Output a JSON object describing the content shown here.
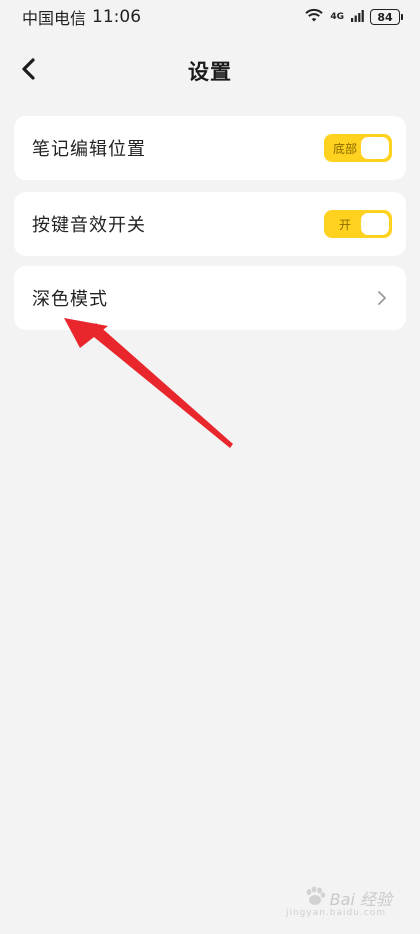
{
  "status_bar": {
    "carrier": "中国电信",
    "time": "11:06",
    "network": "4G",
    "battery": "84"
  },
  "header": {
    "title": "设置"
  },
  "settings": [
    {
      "label": "笔记编辑位置",
      "control": "toggle",
      "toggle_text": "底部"
    },
    {
      "label": "按键音效开关",
      "control": "toggle",
      "toggle_text": "开"
    },
    {
      "label": "深色模式",
      "control": "chevron"
    }
  ],
  "watermark": {
    "brand": "Bai 经验",
    "url": "jingyan.baidu.com"
  },
  "colors": {
    "accent": "#ffd21f",
    "annotation_arrow": "#e8262c",
    "background": "#f3f3f3",
    "card": "#ffffff"
  }
}
